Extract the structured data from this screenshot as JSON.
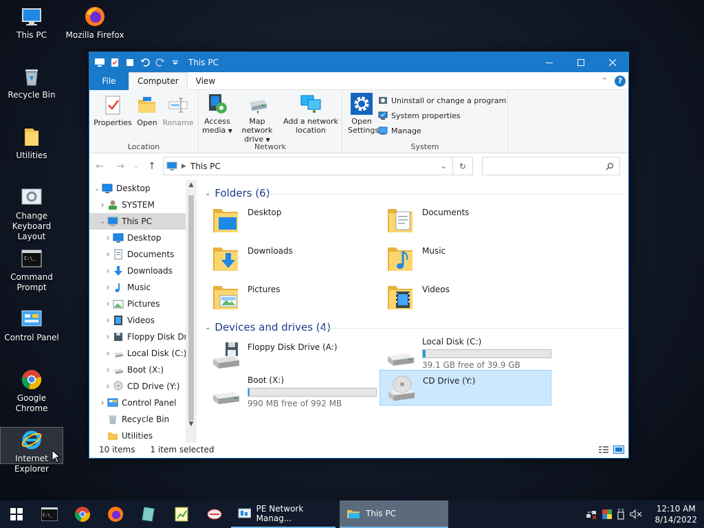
{
  "desktop_icons": [
    {
      "label": "This PC"
    },
    {
      "label": "Mozilla Firefox"
    },
    {
      "label": "Recycle Bin"
    },
    {
      "label": "Utilities"
    },
    {
      "label": "Change Keyboard Layout"
    },
    {
      "label": "Command Prompt"
    },
    {
      "label": "Control Panel"
    },
    {
      "label": "Google Chrome"
    },
    {
      "label": "Internet Explorer"
    }
  ],
  "window": {
    "title": "This PC",
    "tabs": {
      "file": "File",
      "computer": "Computer",
      "view": "View"
    },
    "ribbon": {
      "location_group": "Location",
      "network_group": "Network",
      "system_group": "System",
      "properties": "Properties",
      "open": "Open",
      "rename": "Rename",
      "access_media": "Access media",
      "map_network_drive": "Map network drive",
      "add_network_location": "Add a network location",
      "open_settings": "Open Settings",
      "uninstall": "Uninstall or change a program",
      "system_properties": "System properties",
      "manage": "Manage"
    },
    "address": {
      "path": "This PC",
      "search_placeholder": ""
    },
    "nav_tree": [
      {
        "label": "Desktop",
        "level": 0,
        "expanded": true
      },
      {
        "label": "SYSTEM",
        "level": 1,
        "expanded": false
      },
      {
        "label": "This PC",
        "level": 1,
        "expanded": true,
        "selected": true
      },
      {
        "label": "Desktop",
        "level": 2
      },
      {
        "label": "Documents",
        "level": 2
      },
      {
        "label": "Downloads",
        "level": 2
      },
      {
        "label": "Music",
        "level": 2
      },
      {
        "label": "Pictures",
        "level": 2
      },
      {
        "label": "Videos",
        "level": 2
      },
      {
        "label": "Floppy Disk Dri",
        "level": 2
      },
      {
        "label": "Local Disk (C:)",
        "level": 2
      },
      {
        "label": "Boot (X:)",
        "level": 2
      },
      {
        "label": "CD Drive (Y:)",
        "level": 2
      },
      {
        "label": "Control Panel",
        "level": 1
      },
      {
        "label": "Recycle Bin",
        "level": 1
      },
      {
        "label": "Utilities",
        "level": 1
      }
    ],
    "folders_header": "Folders (6)",
    "folders": [
      {
        "name": "Desktop"
      },
      {
        "name": "Documents"
      },
      {
        "name": "Downloads"
      },
      {
        "name": "Music"
      },
      {
        "name": "Pictures"
      },
      {
        "name": "Videos"
      }
    ],
    "devices_header": "Devices and drives (4)",
    "devices": [
      {
        "name": "Floppy Disk Drive (A:)"
      },
      {
        "name": "Local Disk (C:)",
        "free": "39.1 GB free of 39.9 GB",
        "used_fraction": 0.02
      },
      {
        "name": "Boot (X:)",
        "free": "990 MB free of 992 MB",
        "used_fraction": 0.002
      },
      {
        "name": "CD Drive (Y:)",
        "selected": true
      }
    ],
    "status": {
      "count": "10 items",
      "selection": "1 item selected"
    }
  },
  "taskbar": {
    "tasks": [
      {
        "label": "PE Network Manag..."
      },
      {
        "label": "This PC"
      }
    ],
    "clock_time": "12:10 AM",
    "clock_date": "8/14/2022"
  },
  "colors": {
    "accent": "#1979ca",
    "selection": "#cce8ff",
    "drive_bar": "#26a0da"
  }
}
